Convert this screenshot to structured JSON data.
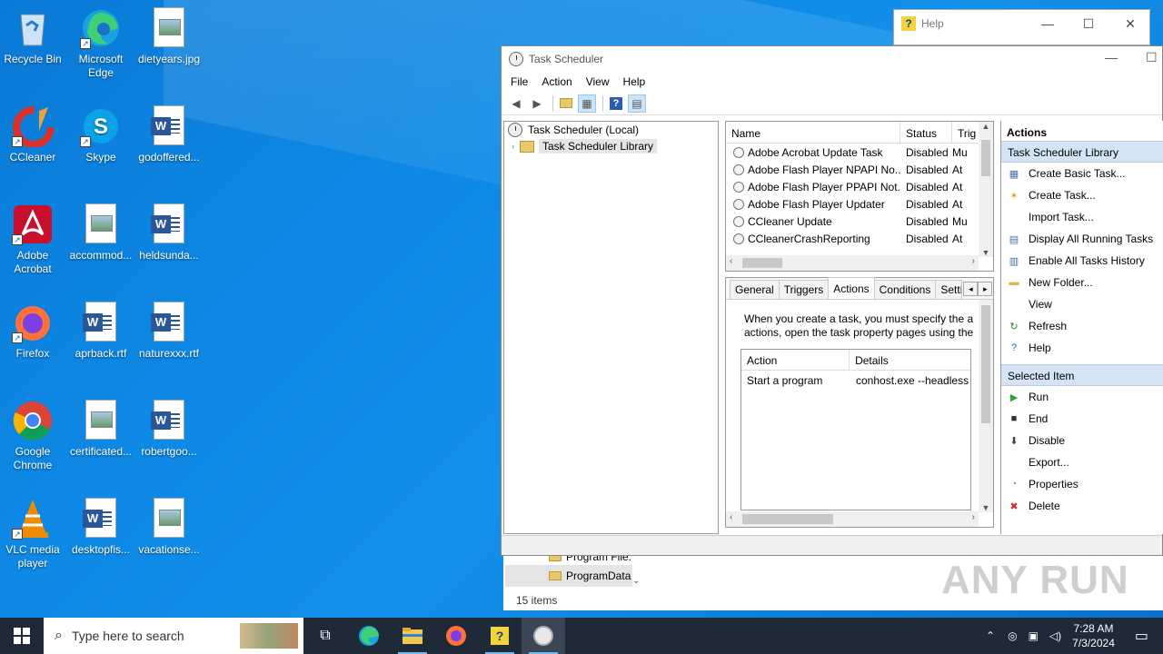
{
  "desktop": {
    "icons": [
      {
        "label": "Recycle Bin"
      },
      {
        "label": "Microsoft Edge"
      },
      {
        "label": "dietyears.jpg"
      },
      {
        "label": "CCleaner"
      },
      {
        "label": "Skype"
      },
      {
        "label": "godoffered..."
      },
      {
        "label": "Adobe Acrobat"
      },
      {
        "label": "accommod..."
      },
      {
        "label": "heldsunda..."
      },
      {
        "label": "Firefox"
      },
      {
        "label": "aprback.rtf"
      },
      {
        "label": "naturexxx.rtf"
      },
      {
        "label": "Google Chrome"
      },
      {
        "label": "certificated..."
      },
      {
        "label": "robertgoo..."
      },
      {
        "label": "VLC media player"
      },
      {
        "label": "desktopfis..."
      },
      {
        "label": "vacationse..."
      }
    ]
  },
  "help_window": {
    "title": "Help"
  },
  "task_scheduler": {
    "title": "Task Scheduler",
    "menu": [
      "File",
      "Action",
      "View",
      "Help"
    ],
    "tree": {
      "root": "Task Scheduler (Local)",
      "child": "Task Scheduler Library"
    },
    "list": {
      "columns": [
        "Name",
        "Status",
        "Trig"
      ],
      "rows": [
        {
          "name": "Adobe Acrobat Update Task",
          "status": "Disabled",
          "trigger": "Mu"
        },
        {
          "name": "Adobe Flash Player NPAPI No...",
          "status": "Disabled",
          "trigger": "At"
        },
        {
          "name": "Adobe Flash Player PPAPI Not...",
          "status": "Disabled",
          "trigger": "At"
        },
        {
          "name": "Adobe Flash Player Updater",
          "status": "Disabled",
          "trigger": "At"
        },
        {
          "name": "CCleaner Update",
          "status": "Disabled",
          "trigger": "Mu"
        },
        {
          "name": "CCleanerCrashReporting",
          "status": "Disabled",
          "trigger": "At"
        }
      ]
    },
    "tabs": [
      "General",
      "Triggers",
      "Actions",
      "Conditions",
      "Setti"
    ],
    "active_tab": "Actions",
    "actions_tab": {
      "description_line1": "When you create a task, you must specify the ac",
      "description_line2": "actions, open the task property pages using the",
      "columns": [
        "Action",
        "Details"
      ],
      "rows": [
        {
          "action": "Start a program",
          "details": "conhost.exe --headless"
        }
      ]
    },
    "actions_pane": {
      "header": "Actions",
      "section1": "Task Scheduler Library",
      "section1_items": [
        {
          "label": "Create Basic Task...",
          "icon": "create-basic-task-icon"
        },
        {
          "label": "Create Task...",
          "icon": "create-task-icon"
        },
        {
          "label": "Import Task...",
          "icon": ""
        },
        {
          "label": "Display All Running Tasks",
          "icon": "running-tasks-icon"
        },
        {
          "label": "Enable All Tasks History",
          "icon": "history-icon"
        },
        {
          "label": "New Folder...",
          "icon": "folder-icon"
        },
        {
          "label": "View",
          "icon": ""
        },
        {
          "label": "Refresh",
          "icon": "refresh-icon"
        },
        {
          "label": "Help",
          "icon": "help-icon"
        }
      ],
      "section2": "Selected Item",
      "section2_items": [
        {
          "label": "Run",
          "icon": "run-icon"
        },
        {
          "label": "End",
          "icon": "end-icon"
        },
        {
          "label": "Disable",
          "icon": "disable-icon"
        },
        {
          "label": "Export...",
          "icon": ""
        },
        {
          "label": "Properties",
          "icon": "properties-icon"
        },
        {
          "label": "Delete",
          "icon": "delete-icon"
        }
      ]
    }
  },
  "explorer": {
    "rows": [
      "Program File.",
      "ProgramData"
    ],
    "item_count": "15 items"
  },
  "taskbar": {
    "search_placeholder": "Type here to search",
    "time": "7:28 AM",
    "date": "7/3/2024"
  },
  "watermark": "ANY RUN"
}
